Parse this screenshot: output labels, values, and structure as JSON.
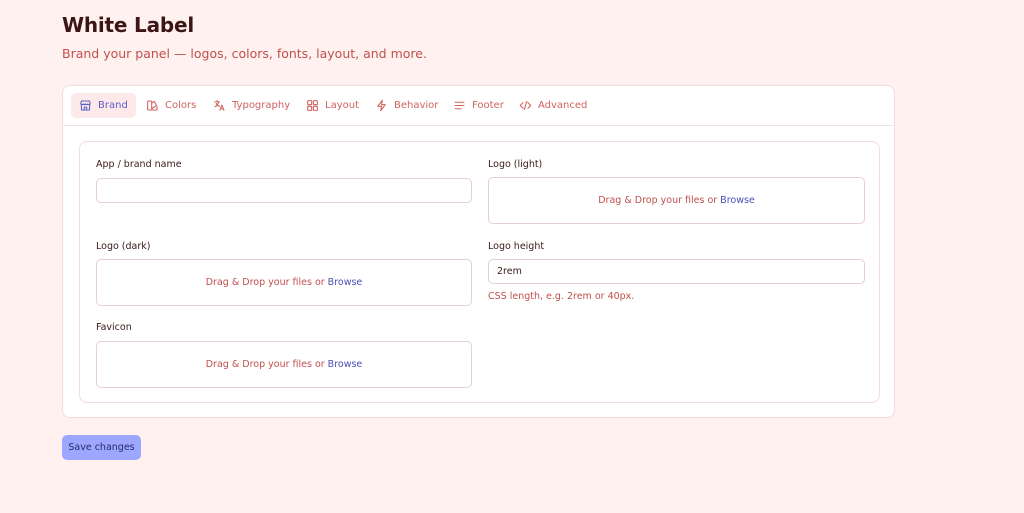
{
  "page": {
    "title": "White Label",
    "subtitle": "Brand your panel — logos, colors, fonts, layout, and more."
  },
  "tabs": [
    {
      "label": "Brand",
      "icon": "store-icon",
      "active": true
    },
    {
      "label": "Colors",
      "icon": "swatch-icon",
      "active": false
    },
    {
      "label": "Typography",
      "icon": "translate-icon",
      "active": false
    },
    {
      "label": "Layout",
      "icon": "grid-icon",
      "active": false
    },
    {
      "label": "Behavior",
      "icon": "bolt-icon",
      "active": false
    },
    {
      "label": "Footer",
      "icon": "lines-icon",
      "active": false
    },
    {
      "label": "Advanced",
      "icon": "code-icon",
      "active": false
    }
  ],
  "form": {
    "app_name": {
      "label": "App / brand name",
      "value": ""
    },
    "logo_light": {
      "label": "Logo (light)"
    },
    "logo_dark": {
      "label": "Logo (dark)"
    },
    "logo_height": {
      "label": "Logo height",
      "value": "2rem",
      "hint": "CSS length, e.g. 2rem or 40px."
    },
    "favicon": {
      "label": "Favicon"
    },
    "dropzone": {
      "text": "Drag & Drop your files or",
      "browse": "Browse"
    }
  },
  "actions": {
    "save_label": "Save changes"
  },
  "colors": {
    "background": "#fff1f0",
    "accent": "#5b5fc7",
    "button": "#9ea7ff",
    "text_muted": "#c0504d"
  }
}
